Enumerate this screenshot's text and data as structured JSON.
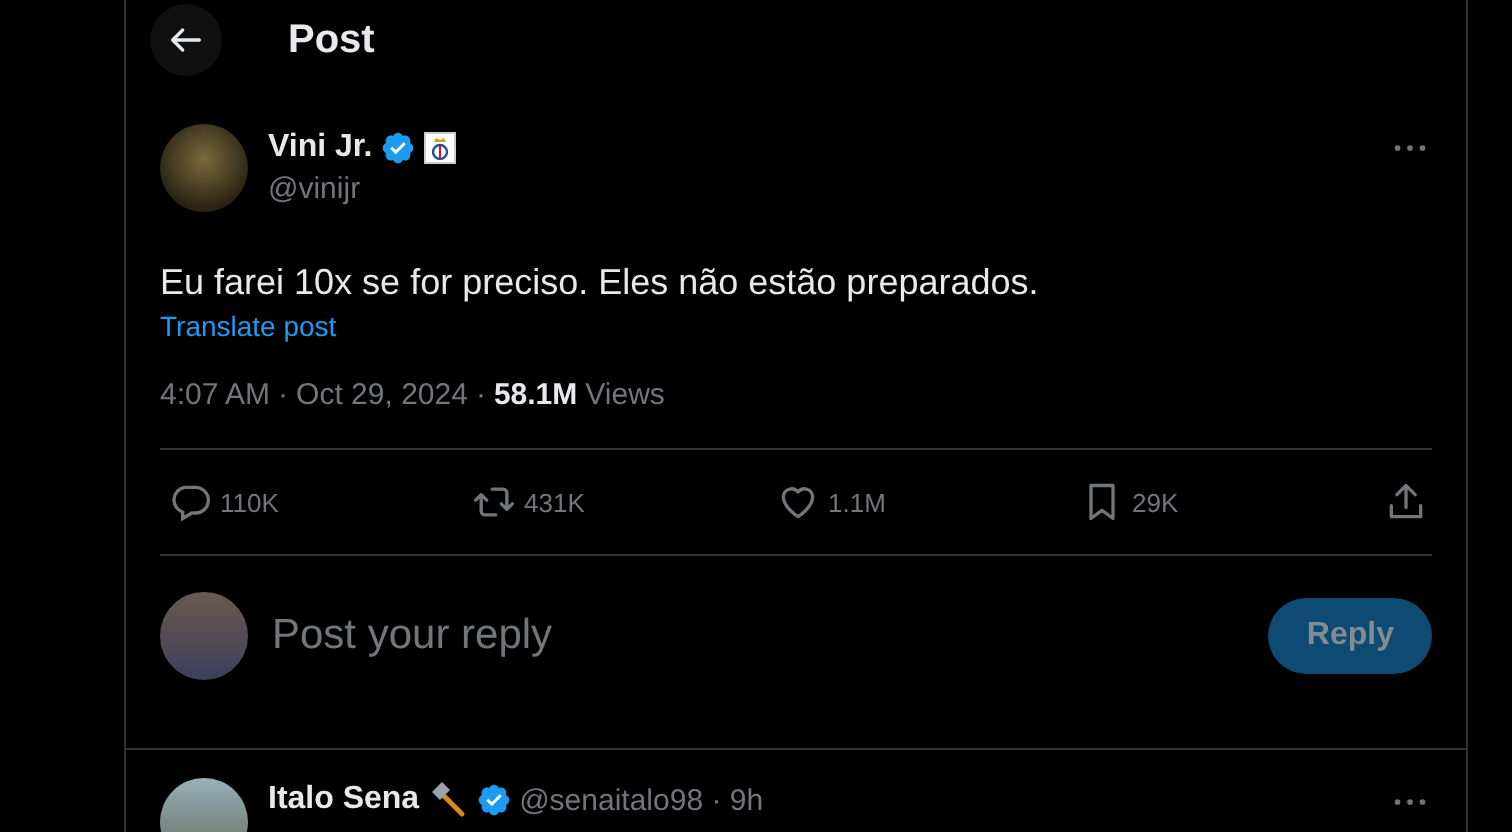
{
  "header": {
    "title": "Post"
  },
  "post": {
    "author": {
      "name": "Vini Jr.",
      "verified": true,
      "handle": "@vinijr"
    },
    "text": "Eu farei 10x se for preciso. Eles não estão preparados.",
    "translate_link": "Translate post",
    "time": "4:07 AM",
    "separator": "·",
    "date": "Oct 29, 2024",
    "views_count": "58.1M",
    "views_label": "Views",
    "actions": [
      {
        "kind": "reply",
        "count": "110K"
      },
      {
        "kind": "repost",
        "count": "431K"
      },
      {
        "kind": "like",
        "count": "1.1M"
      },
      {
        "kind": "bookmark",
        "count": "29K"
      },
      {
        "kind": "share"
      }
    ]
  },
  "composer": {
    "placeholder": "Post your reply",
    "button": {
      "label": "Reply",
      "disabled": true
    }
  },
  "replies": [
    {
      "name": "Italo Sena",
      "verified": true,
      "handle": "@senaitalo98",
      "separator": "·",
      "time": "9h"
    }
  ]
}
